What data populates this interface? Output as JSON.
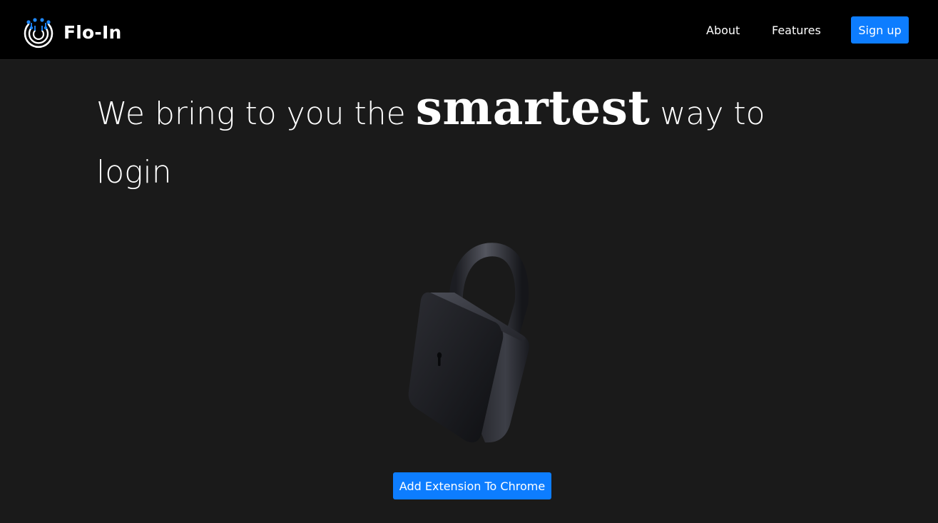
{
  "nav": {
    "brand_name": "Flo-In",
    "brand_logo_icon": "fingerprint-circle-icon",
    "links": [
      {
        "label": "About"
      },
      {
        "label": "Features"
      }
    ],
    "signup_label": "Sign up"
  },
  "hero": {
    "headline_before": "We bring to you the",
    "headline_emphasis": "smartest",
    "headline_after": "way to login",
    "illustration_icon": "padlock-icon"
  },
  "cta": {
    "extension_label": "Add Extension To Chrome"
  },
  "colors": {
    "background": "#1a1a1a",
    "navbar": "#000000",
    "accent": "#0d7dff",
    "logo_dots": "#1e88ff"
  }
}
